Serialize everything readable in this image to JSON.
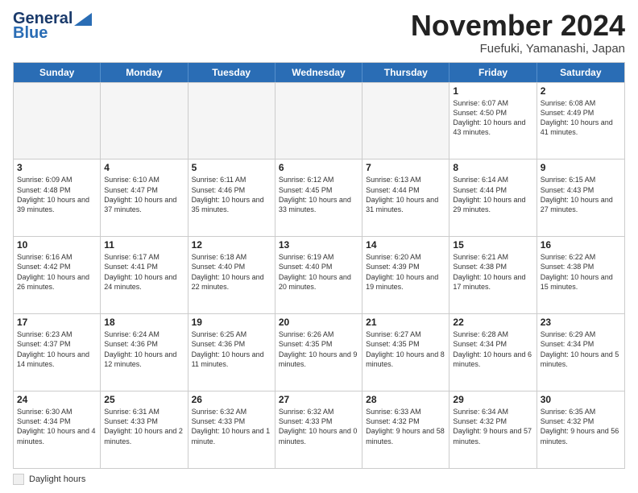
{
  "logo": {
    "line1": "General",
    "line2": "Blue"
  },
  "title": "November 2024",
  "location": "Fuefuki, Yamanashi, Japan",
  "days_of_week": [
    "Sunday",
    "Monday",
    "Tuesday",
    "Wednesday",
    "Thursday",
    "Friday",
    "Saturday"
  ],
  "weeks": [
    [
      {
        "day": "",
        "info": "",
        "shaded": true
      },
      {
        "day": "",
        "info": "",
        "shaded": true
      },
      {
        "day": "",
        "info": "",
        "shaded": true
      },
      {
        "day": "",
        "info": "",
        "shaded": true
      },
      {
        "day": "",
        "info": "",
        "shaded": true
      },
      {
        "day": "1",
        "info": "Sunrise: 6:07 AM\nSunset: 4:50 PM\nDaylight: 10 hours and 43 minutes.",
        "shaded": false
      },
      {
        "day": "2",
        "info": "Sunrise: 6:08 AM\nSunset: 4:49 PM\nDaylight: 10 hours and 41 minutes.",
        "shaded": false
      }
    ],
    [
      {
        "day": "3",
        "info": "Sunrise: 6:09 AM\nSunset: 4:48 PM\nDaylight: 10 hours and 39 minutes.",
        "shaded": false
      },
      {
        "day": "4",
        "info": "Sunrise: 6:10 AM\nSunset: 4:47 PM\nDaylight: 10 hours and 37 minutes.",
        "shaded": false
      },
      {
        "day": "5",
        "info": "Sunrise: 6:11 AM\nSunset: 4:46 PM\nDaylight: 10 hours and 35 minutes.",
        "shaded": false
      },
      {
        "day": "6",
        "info": "Sunrise: 6:12 AM\nSunset: 4:45 PM\nDaylight: 10 hours and 33 minutes.",
        "shaded": false
      },
      {
        "day": "7",
        "info": "Sunrise: 6:13 AM\nSunset: 4:44 PM\nDaylight: 10 hours and 31 minutes.",
        "shaded": false
      },
      {
        "day": "8",
        "info": "Sunrise: 6:14 AM\nSunset: 4:44 PM\nDaylight: 10 hours and 29 minutes.",
        "shaded": false
      },
      {
        "day": "9",
        "info": "Sunrise: 6:15 AM\nSunset: 4:43 PM\nDaylight: 10 hours and 27 minutes.",
        "shaded": false
      }
    ],
    [
      {
        "day": "10",
        "info": "Sunrise: 6:16 AM\nSunset: 4:42 PM\nDaylight: 10 hours and 26 minutes.",
        "shaded": false
      },
      {
        "day": "11",
        "info": "Sunrise: 6:17 AM\nSunset: 4:41 PM\nDaylight: 10 hours and 24 minutes.",
        "shaded": false
      },
      {
        "day": "12",
        "info": "Sunrise: 6:18 AM\nSunset: 4:40 PM\nDaylight: 10 hours and 22 minutes.",
        "shaded": false
      },
      {
        "day": "13",
        "info": "Sunrise: 6:19 AM\nSunset: 4:40 PM\nDaylight: 10 hours and 20 minutes.",
        "shaded": false
      },
      {
        "day": "14",
        "info": "Sunrise: 6:20 AM\nSunset: 4:39 PM\nDaylight: 10 hours and 19 minutes.",
        "shaded": false
      },
      {
        "day": "15",
        "info": "Sunrise: 6:21 AM\nSunset: 4:38 PM\nDaylight: 10 hours and 17 minutes.",
        "shaded": false
      },
      {
        "day": "16",
        "info": "Sunrise: 6:22 AM\nSunset: 4:38 PM\nDaylight: 10 hours and 15 minutes.",
        "shaded": false
      }
    ],
    [
      {
        "day": "17",
        "info": "Sunrise: 6:23 AM\nSunset: 4:37 PM\nDaylight: 10 hours and 14 minutes.",
        "shaded": false
      },
      {
        "day": "18",
        "info": "Sunrise: 6:24 AM\nSunset: 4:36 PM\nDaylight: 10 hours and 12 minutes.",
        "shaded": false
      },
      {
        "day": "19",
        "info": "Sunrise: 6:25 AM\nSunset: 4:36 PM\nDaylight: 10 hours and 11 minutes.",
        "shaded": false
      },
      {
        "day": "20",
        "info": "Sunrise: 6:26 AM\nSunset: 4:35 PM\nDaylight: 10 hours and 9 minutes.",
        "shaded": false
      },
      {
        "day": "21",
        "info": "Sunrise: 6:27 AM\nSunset: 4:35 PM\nDaylight: 10 hours and 8 minutes.",
        "shaded": false
      },
      {
        "day": "22",
        "info": "Sunrise: 6:28 AM\nSunset: 4:34 PM\nDaylight: 10 hours and 6 minutes.",
        "shaded": false
      },
      {
        "day": "23",
        "info": "Sunrise: 6:29 AM\nSunset: 4:34 PM\nDaylight: 10 hours and 5 minutes.",
        "shaded": false
      }
    ],
    [
      {
        "day": "24",
        "info": "Sunrise: 6:30 AM\nSunset: 4:34 PM\nDaylight: 10 hours and 4 minutes.",
        "shaded": false
      },
      {
        "day": "25",
        "info": "Sunrise: 6:31 AM\nSunset: 4:33 PM\nDaylight: 10 hours and 2 minutes.",
        "shaded": false
      },
      {
        "day": "26",
        "info": "Sunrise: 6:32 AM\nSunset: 4:33 PM\nDaylight: 10 hours and 1 minute.",
        "shaded": false
      },
      {
        "day": "27",
        "info": "Sunrise: 6:32 AM\nSunset: 4:33 PM\nDaylight: 10 hours and 0 minutes.",
        "shaded": false
      },
      {
        "day": "28",
        "info": "Sunrise: 6:33 AM\nSunset: 4:32 PM\nDaylight: 9 hours and 58 minutes.",
        "shaded": false
      },
      {
        "day": "29",
        "info": "Sunrise: 6:34 AM\nSunset: 4:32 PM\nDaylight: 9 hours and 57 minutes.",
        "shaded": false
      },
      {
        "day": "30",
        "info": "Sunrise: 6:35 AM\nSunset: 4:32 PM\nDaylight: 9 hours and 56 minutes.",
        "shaded": false
      }
    ]
  ],
  "legend": {
    "box_label": "Daylight hours"
  }
}
